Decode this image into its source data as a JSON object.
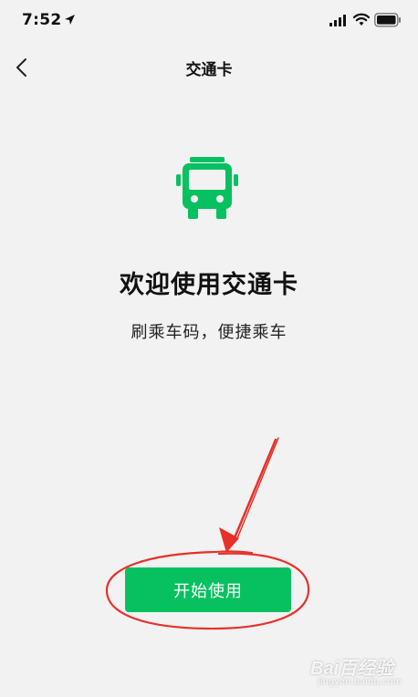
{
  "status_bar": {
    "time": "7:52",
    "icons": [
      "location-arrow-icon",
      "signal-icon",
      "wifi-icon",
      "battery-icon"
    ]
  },
  "nav": {
    "back_icon": "chevron-left-icon",
    "title": "交通卡"
  },
  "main": {
    "icon": "bus-icon",
    "title": "欢迎使用交通卡",
    "subtitle": "刷乘车码，便捷乘车",
    "start_button_label": "开始使用"
  },
  "annotation": {
    "type": "red-arrow-and-ellipse",
    "color": "#e8302a"
  },
  "watermark": {
    "text": "Bai百经验",
    "sub": "jingyan.baidu.com"
  },
  "colors": {
    "accent": "#07c160",
    "background": "#f2f2f2",
    "annotation": "#e8302a"
  }
}
